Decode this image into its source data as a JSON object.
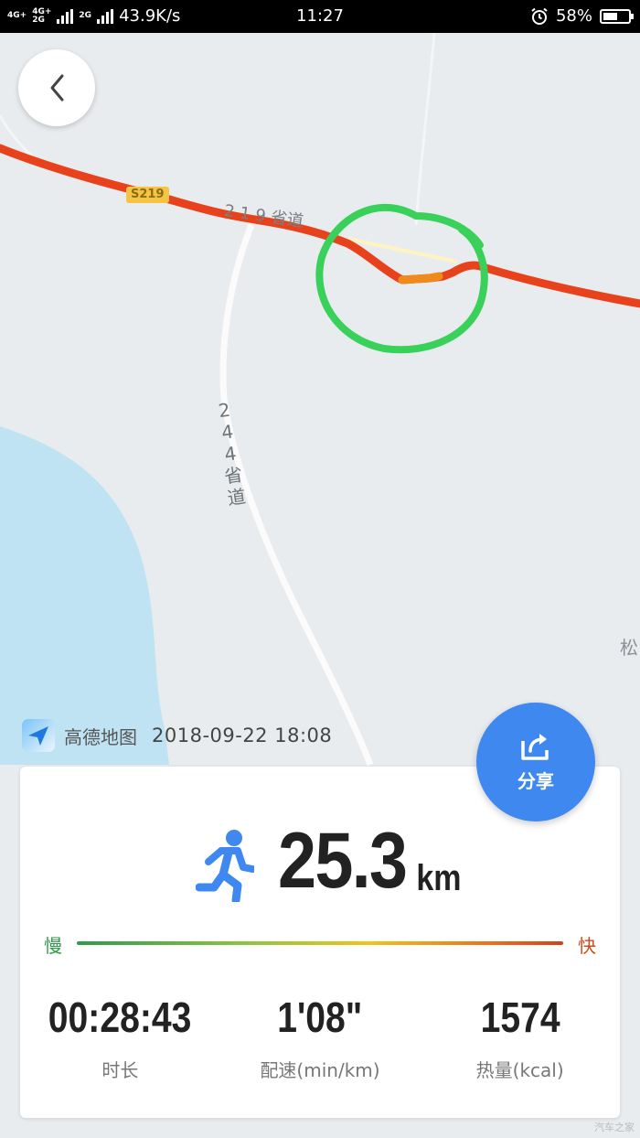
{
  "status_bar": {
    "net_badge_1": "4G+",
    "net_badge_2": "4G+",
    "net_badge_3": "2G",
    "net_badge_4": "2G",
    "speed": "43.9K/s",
    "time": "11:27",
    "battery": "58%",
    "battery_level": 0.58
  },
  "map": {
    "road_tag": "S219",
    "road_name_top": "2 1 9 省道",
    "road_name_vertical": [
      "2",
      "4",
      "4",
      "省",
      "道"
    ],
    "edge_label": "松",
    "colors": {
      "route": "#e8421c",
      "highlight_circle": "#39d15a",
      "water": "#bfe3f3",
      "land": "#e8ecee"
    }
  },
  "nav": {
    "back_icon": "chevron-left-icon"
  },
  "brand": {
    "name": "高德地图",
    "datetime": "2018-09-22  18:08"
  },
  "share": {
    "label": "分享",
    "icon": "share-icon"
  },
  "summary": {
    "distance_value": "25.3",
    "distance_unit": "km",
    "speed_slow": "慢",
    "speed_fast": "快",
    "stats": [
      {
        "value": "00:28:43",
        "label": "时长"
      },
      {
        "value": "1'08\"",
        "label": "配速(min/km)"
      },
      {
        "value": "1574",
        "label": "热量(kcal)"
      }
    ]
  },
  "watermark": "汽车之家"
}
